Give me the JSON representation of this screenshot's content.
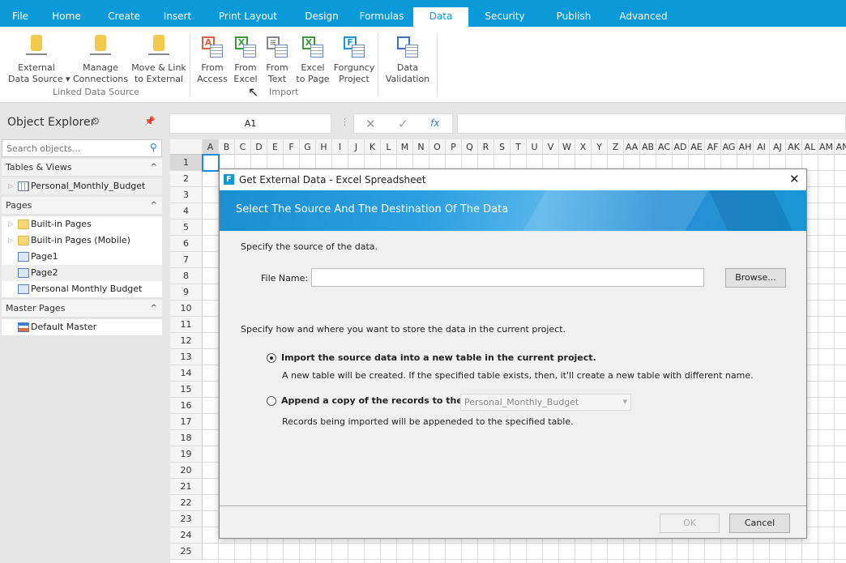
{
  "menu_tabs": [
    "File",
    "Home",
    "Create",
    "Insert",
    "Print Layout",
    "Design",
    "Formulas",
    "Data",
    "Security",
    "Publish",
    "Advanced"
  ],
  "active_tab": "Data",
  "ribbon": {
    "linked": {
      "group_label": "Linked Data Source",
      "buttons": [
        {
          "l1": "External",
          "l2": "Data Source ▾"
        },
        {
          "l1": "Manage",
          "l2": "Connections"
        },
        {
          "l1": "Move & Link",
          "l2": "to External"
        }
      ]
    },
    "import": {
      "group_label": "Import",
      "buttons": [
        {
          "l1": "From",
          "l2": "Access"
        },
        {
          "l1": "From",
          "l2": "Excel"
        },
        {
          "l1": "From",
          "l2": "Text"
        },
        {
          "l1": "Excel",
          "l2": "to Page"
        },
        {
          "l1": "Forguncy",
          "l2": "Project"
        }
      ]
    },
    "validation": {
      "buttons": [
        {
          "l1": "Data",
          "l2": "Validation"
        }
      ]
    }
  },
  "object_explorer": {
    "title": "Object Explorer",
    "search_placeholder": "Search objects...",
    "tables_section": "Tables & Views",
    "tables": [
      "Personal_Monthly_Budget"
    ],
    "pages_section": "Pages",
    "pages": [
      "Built-in Pages",
      "Built-in Pages (Mobile)",
      "Page1",
      "Page2",
      "Personal Monthly Budget"
    ],
    "master_section": "Master Pages",
    "masters": [
      "Default Master"
    ]
  },
  "formula_bar": {
    "cell_ref": "A1",
    "cancel": "✕",
    "confirm": "✓",
    "fx": "fx",
    "value": ""
  },
  "grid": {
    "columns": [
      "A",
      "B",
      "C",
      "D",
      "E",
      "F",
      "G",
      "H",
      "I",
      "J",
      "K",
      "L",
      "M",
      "N",
      "O",
      "P",
      "Q",
      "R",
      "S",
      "T",
      "U",
      "V",
      "W",
      "X",
      "Y",
      "Z",
      "AA",
      "AB",
      "AC",
      "AD",
      "AE",
      "AF",
      "AG",
      "AH",
      "AI",
      "AJ",
      "AK",
      "AL",
      "AM",
      "AN"
    ],
    "rows": 25,
    "selected_cell": "A1"
  },
  "dialog": {
    "title": "Get External Data - Excel Spreadsheet",
    "banner": "Select The Source And The Destination Of The Data",
    "source_prompt": "Specify the source of the data.",
    "file_label": "File Name:",
    "file_value": "",
    "browse": "Browse...",
    "dest_prompt": "Specify how and where you want to store the data in the current project.",
    "opt1": {
      "label": "Import the source data into a new table in the current project.",
      "desc": "A new table will be created. If the specified table exists, then, it'll create a new table with different name.",
      "checked": true
    },
    "opt2": {
      "label": "Append a copy of the records to the table:",
      "desc": "Records being imported will be appeneded to the specified table.",
      "checked": false,
      "table": "Personal_Monthly_Budget"
    },
    "ok": "OK",
    "cancel": "Cancel"
  },
  "colors": {
    "accent": "#0a9ad9"
  }
}
